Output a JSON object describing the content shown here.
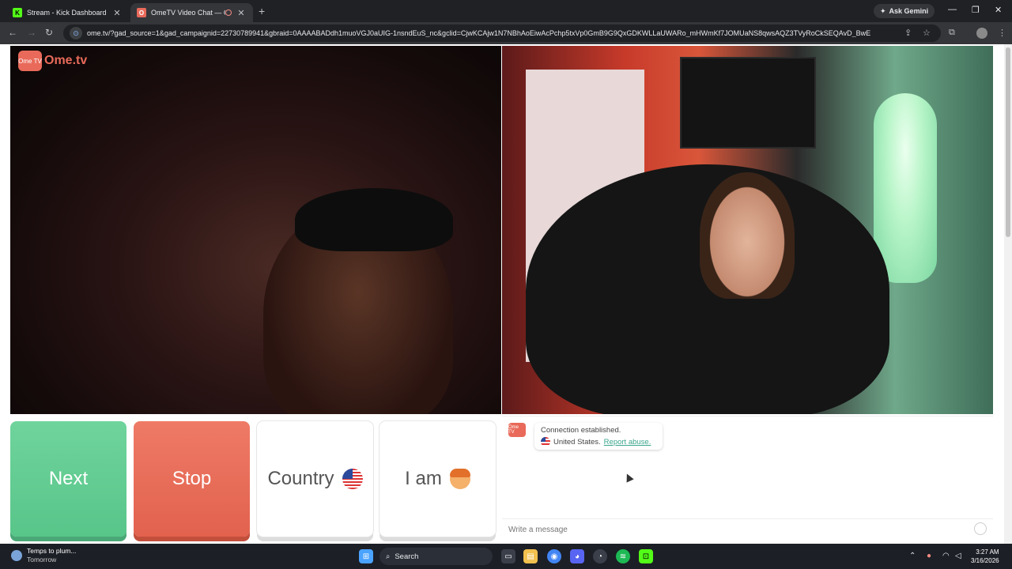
{
  "browser": {
    "tabs": [
      {
        "title": "Stream - Kick Dashboard",
        "favicon": "K",
        "favicon_color": "#53fc18",
        "active": false
      },
      {
        "title": "OmeTV Video Chat — Ome",
        "favicon": "O",
        "favicon_color": "#e96a5a",
        "active": true
      }
    ],
    "ask_gemini": "Ask Gemini",
    "url": "ome.tv/?gad_source=1&gad_campaignid=22730789941&gbraid=0AAAABADdh1muoVGJ0aUIG-1nsndEuS_nc&gclid=CjwKCAjw1N7NBhAoEiwAcPchp5txVp0GmB9G9QxGDKWLLaUWARo_mHWmKf7JOMUaNS8qwsAQZ3TVyRoCkSEQAvD_BwE"
  },
  "logo": {
    "badge": "Ome TV",
    "brand": "Ome.tv"
  },
  "buttons": {
    "next": "Next",
    "stop": "Stop",
    "country": "Country",
    "iam": "I am"
  },
  "chat": {
    "avatar": "Ome TV",
    "status": "Connection established.",
    "country": "United States.",
    "report": "Report abuse.",
    "placeholder": "Write a message"
  },
  "taskbar": {
    "weather_title": "Temps to plum...",
    "weather_sub": "Tomorrow",
    "search": "Search",
    "time": "3:27 AM",
    "date": "3/16/2026"
  },
  "colors": {
    "next": "#5fca8e",
    "stop": "#e96a55",
    "accent": "#3aa58c"
  }
}
